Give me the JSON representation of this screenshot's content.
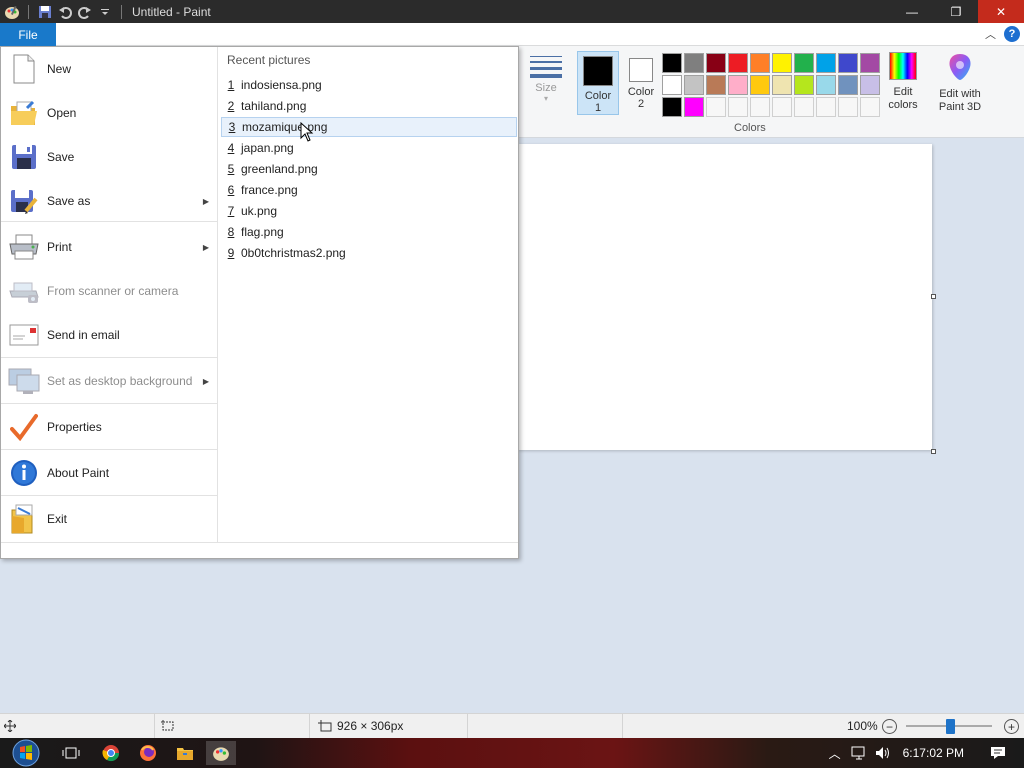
{
  "window": {
    "title": "Untitled - Paint",
    "minimize": "—",
    "maximize": "❐",
    "close": "✕"
  },
  "ribbon": {
    "size_label": "Size",
    "color1_label_a": "Color",
    "color1_label_b": "1",
    "color2_label_a": "Color",
    "color2_label_b": "2",
    "colors_group_label": "Colors",
    "edit_colors_a": "Edit",
    "edit_colors_b": "colors",
    "paint3d_a": "Edit with",
    "paint3d_b": "Paint 3D",
    "help": "?",
    "color1": "#000000",
    "color2": "#ffffff",
    "palette": [
      "#000000",
      "#7f7f7f",
      "#880015",
      "#ed1c24",
      "#ff7f27",
      "#fff200",
      "#22b14c",
      "#00a2e8",
      "#3f48cc",
      "#a349a4",
      "#ffffff",
      "#c3c3c3",
      "#b97a57",
      "#ffaec9",
      "#ffc90e",
      "#efe4b0",
      "#b5e61d",
      "#99d9ea",
      "#7092be",
      "#c8bfe7",
      "#000000",
      "#ff00ff",
      "",
      "",
      "",
      "",
      "",
      "",
      "",
      ""
    ]
  },
  "file_menu": {
    "tab_label": "File",
    "items": [
      {
        "label": "New",
        "icon": "new-file-icon",
        "disabled": false,
        "submenu": false
      },
      {
        "label": "Open",
        "icon": "open-folder-icon",
        "disabled": false,
        "submenu": false
      },
      {
        "label": "Save",
        "icon": "floppy-icon",
        "disabled": false,
        "submenu": false
      },
      {
        "label": "Save as",
        "icon": "save-as-icon",
        "disabled": false,
        "submenu": true
      },
      {
        "label": "Print",
        "icon": "printer-icon",
        "disabled": false,
        "submenu": true
      },
      {
        "label": "From scanner or camera",
        "icon": "scanner-icon",
        "disabled": true,
        "submenu": false
      },
      {
        "label": "Send in email",
        "icon": "email-icon",
        "disabled": false,
        "submenu": false
      },
      {
        "label": "Set as desktop background",
        "icon": "desktop-background-icon",
        "disabled": true,
        "submenu": true
      },
      {
        "label": "Properties",
        "icon": "checkmark-icon",
        "disabled": false,
        "submenu": false
      },
      {
        "label": "About Paint",
        "icon": "info-icon",
        "disabled": false,
        "submenu": false
      },
      {
        "label": "Exit",
        "icon": "exit-icon",
        "disabled": false,
        "submenu": false
      }
    ],
    "recent_title": "Recent pictures",
    "recent": [
      {
        "num": "1",
        "name": "indosiensa.png"
      },
      {
        "num": "2",
        "name": "tahiland.png"
      },
      {
        "num": "3",
        "name": "mozamique.png"
      },
      {
        "num": "4",
        "name": "japan.png"
      },
      {
        "num": "5",
        "name": "greenland.png"
      },
      {
        "num": "6",
        "name": "france.png"
      },
      {
        "num": "7",
        "name": "uk.png"
      },
      {
        "num": "8",
        "name": "flag.png"
      },
      {
        "num": "9",
        "name": "0b0tchristmas2.png"
      }
    ]
  },
  "statusbar": {
    "canvas_size": "926 × 306px",
    "zoom": "100%",
    "zoom_minus": "−",
    "zoom_plus": "+"
  },
  "taskbar": {
    "clock": "6:17:02 PM"
  }
}
